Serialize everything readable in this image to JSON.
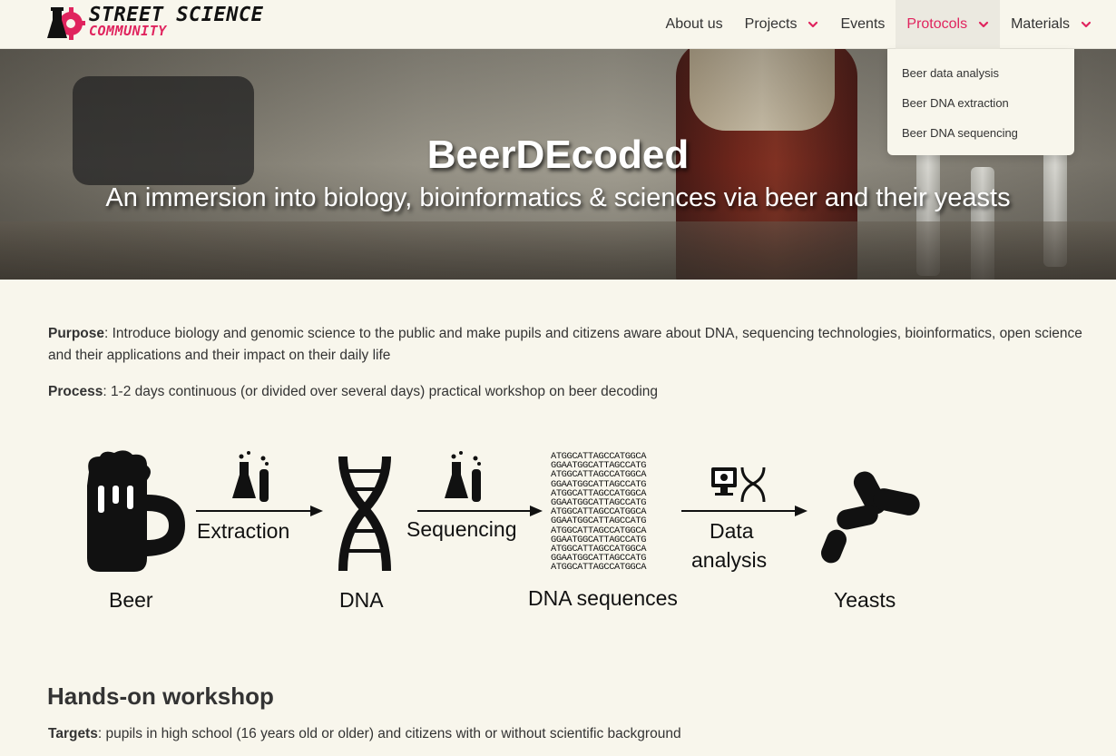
{
  "nav": {
    "logo_line1": "STREET SCIENCE",
    "logo_line2": "COMMUNITY",
    "items": [
      {
        "label": "About us",
        "has_menu": false
      },
      {
        "label": "Projects",
        "has_menu": true
      },
      {
        "label": "Events",
        "has_menu": false
      },
      {
        "label": "Protocols",
        "has_menu": true,
        "active": true
      },
      {
        "label": "Materials",
        "has_menu": true
      }
    ],
    "dropdown": [
      "Beer data analysis",
      "Beer DNA extraction",
      "Beer DNA sequencing"
    ]
  },
  "hero": {
    "title": "BeerDEcoded",
    "subtitle": "An immersion into biology, bioinformatics & sciences via beer and their yeasts"
  },
  "intro": {
    "purpose_label": "Purpose",
    "purpose_text": ": Introduce biology and genomic science to the public and make pupils and citizens aware about DNA, sequencing technologies, bioinformatics, open science and their applications and their impact on their daily life",
    "process_label": "Process",
    "process_text": ": 1-2 days continuous (or divided over several days) practical workshop on beer decoding"
  },
  "diagram": {
    "beer": "Beer",
    "extraction": "Extraction",
    "dna": "DNA",
    "sequencing": "Sequencing",
    "dna_sequences": "DNA sequences",
    "data": "Data",
    "analysis": "analysis",
    "yeasts": "Yeasts",
    "sequences": [
      "ATGGCATTAGCCATGGCA",
      "GGAATGGCATTAGCCATG",
      "ATGGCATTAGCCATGGCA",
      "GGAATGGCATTAGCCATG",
      "ATGGCATTAGCCATGGCA",
      "GGAATGGCATTAGCCATG",
      "ATGGCATTAGCCATGGCA",
      "GGAATGGCATTAGCCATG",
      "ATGGCATTAGCCATGGCA",
      "GGAATGGCATTAGCCATG",
      "ATGGCATTAGCCATGGCA",
      "GGAATGGCATTAGCCATG",
      "ATGGCATTAGCCATGGCA"
    ]
  },
  "workshop": {
    "heading": "Hands-on workshop",
    "targets_label": "Targets",
    "targets_text": ": pupils in high school (16 years old or older) and citizens with or without scientific background"
  },
  "colors": {
    "accent": "#e0245e",
    "background": "#f8f6ec"
  }
}
